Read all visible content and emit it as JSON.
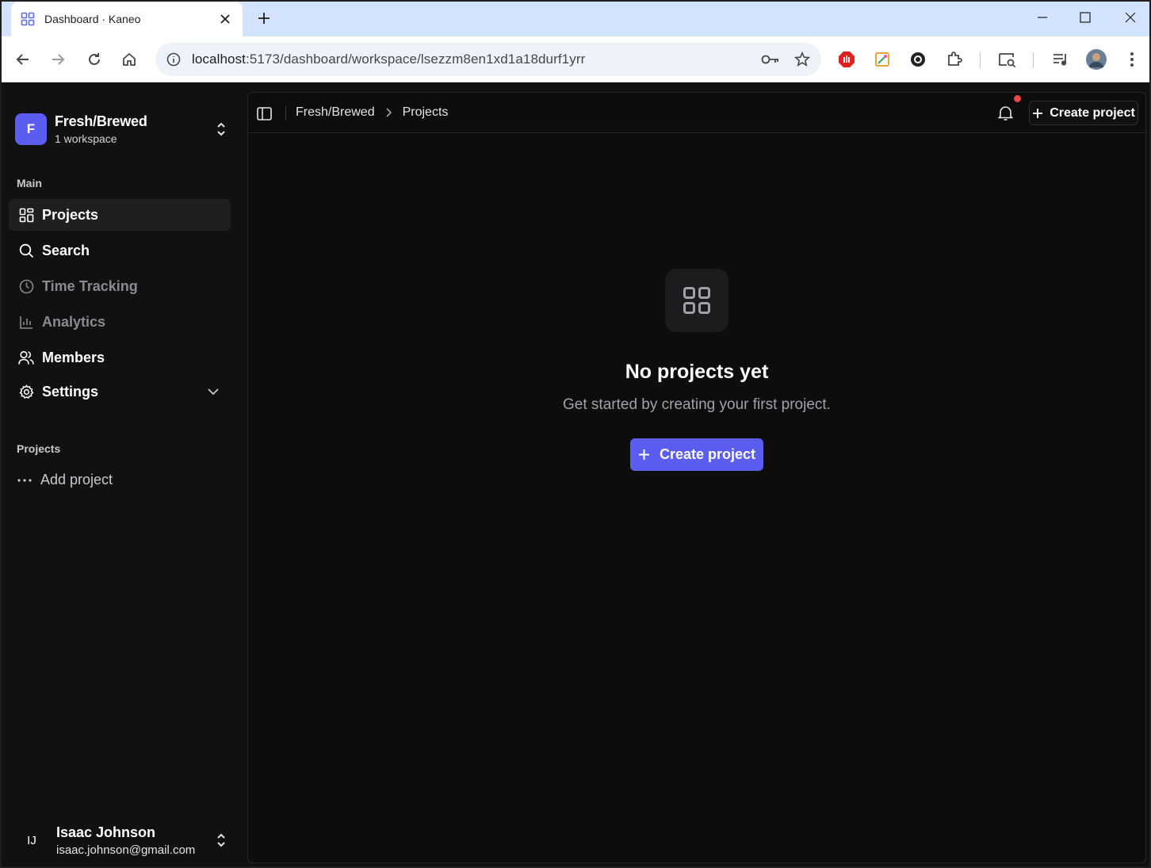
{
  "browser": {
    "tab_title": "Dashboard · Kaneo",
    "url_host": "localhost",
    "url_path": ":5173/dashboard/workspace/lsezzm8en1xd1a18durf1yrr"
  },
  "sidebar": {
    "workspace": {
      "initial": "F",
      "name": "Fresh/Brewed",
      "subtitle": "1 workspace"
    },
    "main_label": "Main",
    "nav": [
      {
        "label": "Projects",
        "icon": "grid-icon",
        "active": true
      },
      {
        "label": "Search",
        "icon": "search-icon"
      },
      {
        "label": "Time Tracking",
        "icon": "clock-icon",
        "disabled": true
      },
      {
        "label": "Analytics",
        "icon": "bar-chart-icon",
        "disabled": true
      },
      {
        "label": "Members",
        "icon": "users-icon"
      },
      {
        "label": "Settings",
        "icon": "gear-icon",
        "expandable": true
      }
    ],
    "projects_label": "Projects",
    "add_project": "Add project",
    "user": {
      "initials": "IJ",
      "name": "Isaac Johnson",
      "email": "isaac.johnson@gmail.com"
    }
  },
  "topbar": {
    "breadcrumb": [
      "Fresh/Brewed",
      "Projects"
    ],
    "create_label": "Create project"
  },
  "empty_state": {
    "title": "No projects yet",
    "subtitle": "Get started by creating your first project.",
    "button_label": "Create project"
  },
  "colors": {
    "accent": "#5b5cf0",
    "background": "#111112",
    "notification_dot": "#ef4444"
  }
}
